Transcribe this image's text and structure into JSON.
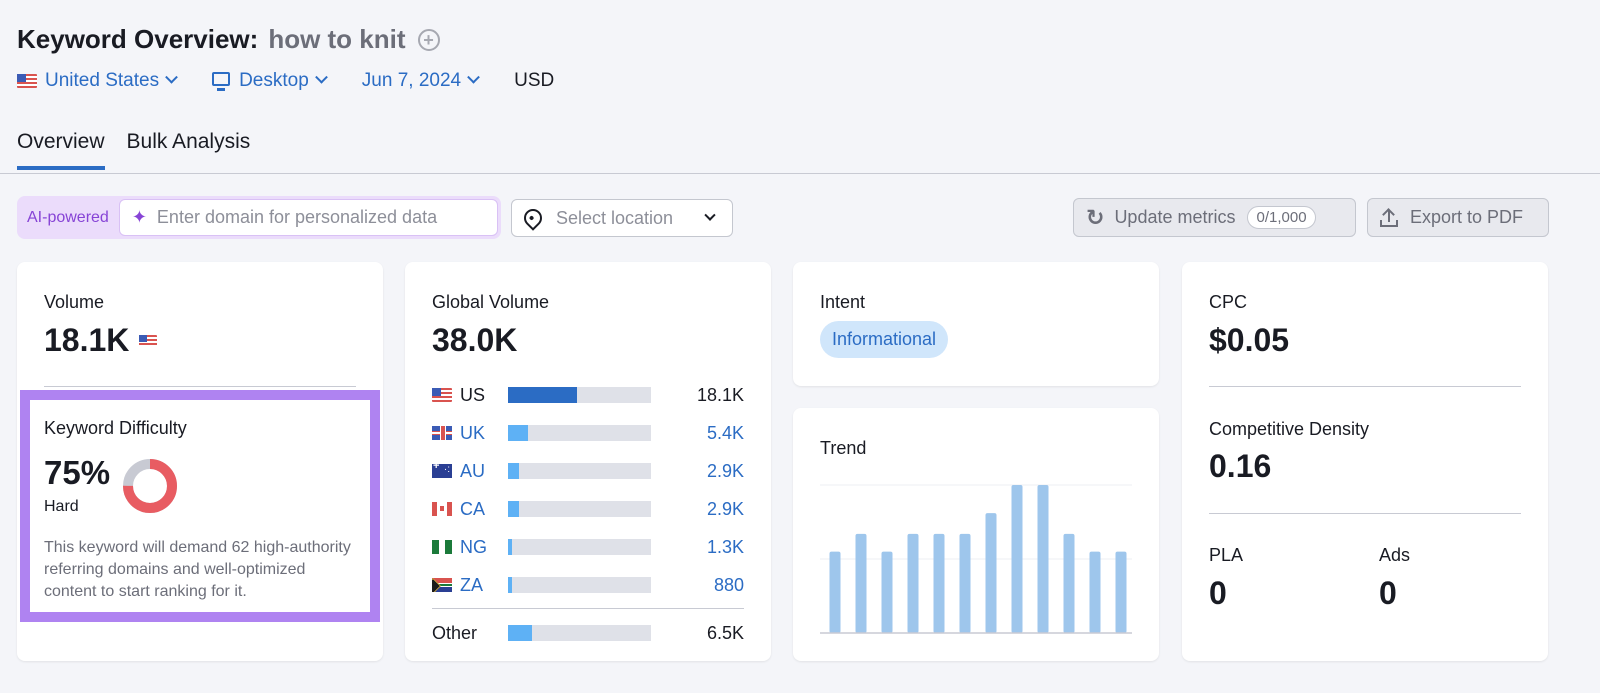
{
  "header": {
    "title": "Keyword Overview:",
    "keyword": "how to knit",
    "add_icon": "plus-circle-icon"
  },
  "filters": {
    "country": "United States",
    "device": "Desktop",
    "date": "Jun 7, 2024",
    "currency": "USD"
  },
  "tabs": [
    {
      "label": "Overview",
      "active": true
    },
    {
      "label": "Bulk Analysis",
      "active": false
    }
  ],
  "toolbar": {
    "ai_label": "AI-powered",
    "domain_placeholder": "Enter domain for personalized data",
    "location_placeholder": "Select location",
    "update_label": "Update metrics",
    "update_counter": "0/1,000",
    "export_label": "Export to PDF"
  },
  "colors": {
    "accent": "#2b6cc4",
    "ai_purple": "#8744d6",
    "highlight_border": "#af83f1",
    "difficulty_hard": "#e85c62",
    "trend_bar": "#9ec6ec"
  },
  "volume": {
    "label": "Volume",
    "value": "18.1K"
  },
  "keyword_difficulty": {
    "label": "Keyword Difficulty",
    "value": "75%",
    "percent": 75,
    "level": "Hard",
    "description": "This keyword will demand 62 high-authority referring domains and well-optimized content to start ranking for it."
  },
  "global_volume": {
    "label": "Global Volume",
    "value": "38.0K",
    "countries": [
      {
        "code": "US",
        "value": "18.1K",
        "share": 0.48,
        "flag": "us"
      },
      {
        "code": "UK",
        "value": "5.4K",
        "share": 0.14,
        "flag": "gb"
      },
      {
        "code": "AU",
        "value": "2.9K",
        "share": 0.08,
        "flag": "au"
      },
      {
        "code": "CA",
        "value": "2.9K",
        "share": 0.08,
        "flag": "ca"
      },
      {
        "code": "NG",
        "value": "1.3K",
        "share": 0.03,
        "flag": "ng"
      },
      {
        "code": "ZA",
        "value": "880",
        "share": 0.025,
        "flag": "za"
      }
    ],
    "other": {
      "label": "Other",
      "value": "6.5K",
      "share": 0.17
    }
  },
  "intent": {
    "label": "Intent",
    "value": "Informational"
  },
  "trend": {
    "label": "Trend",
    "relative_values": [
      0.55,
      0.67,
      0.55,
      0.67,
      0.67,
      0.67,
      0.81,
      1.0,
      1.0,
      0.67,
      0.55,
      0.55
    ]
  },
  "cpc": {
    "label": "CPC",
    "value": "$0.05"
  },
  "competitive_density": {
    "label": "Competitive Density",
    "value": "0.16"
  },
  "pla": {
    "label": "PLA",
    "value": "0"
  },
  "ads": {
    "label": "Ads",
    "value": "0"
  }
}
